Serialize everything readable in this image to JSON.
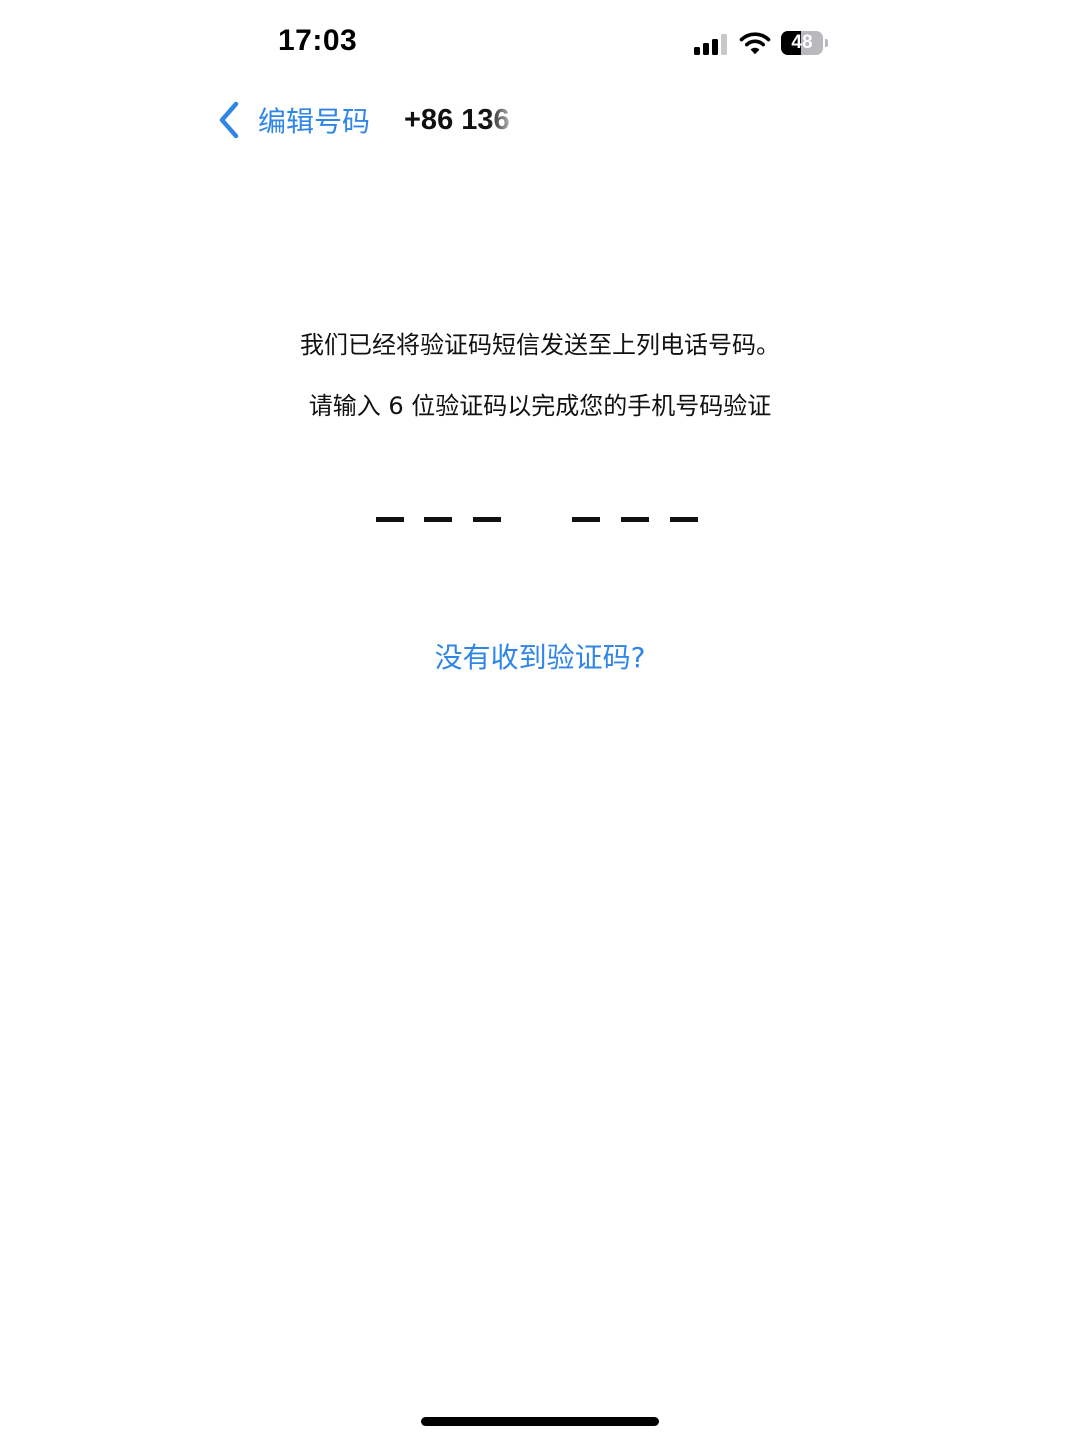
{
  "status_bar": {
    "time": "17:03",
    "battery_level": "48",
    "battery_fraction": 0.48,
    "signal_bars_active": 3,
    "signal_bars_total": 4,
    "icons": [
      "cellular-signal-icon",
      "wifi-icon",
      "battery-icon"
    ]
  },
  "nav": {
    "back_label": "编辑号码",
    "back_icon": "chevron-left-icon",
    "phone_number": "+86 136"
  },
  "content": {
    "line1": "我们已经将验证码短信发送至上列电话号码。",
    "line2": "请输入 6 位验证码以完成您的手机号码验证",
    "code_length": 6,
    "code_value": "",
    "resend_link": "没有收到验证码?"
  },
  "colors": {
    "accent": "#2f86e6",
    "text": "#111111",
    "background": "#ffffff"
  }
}
